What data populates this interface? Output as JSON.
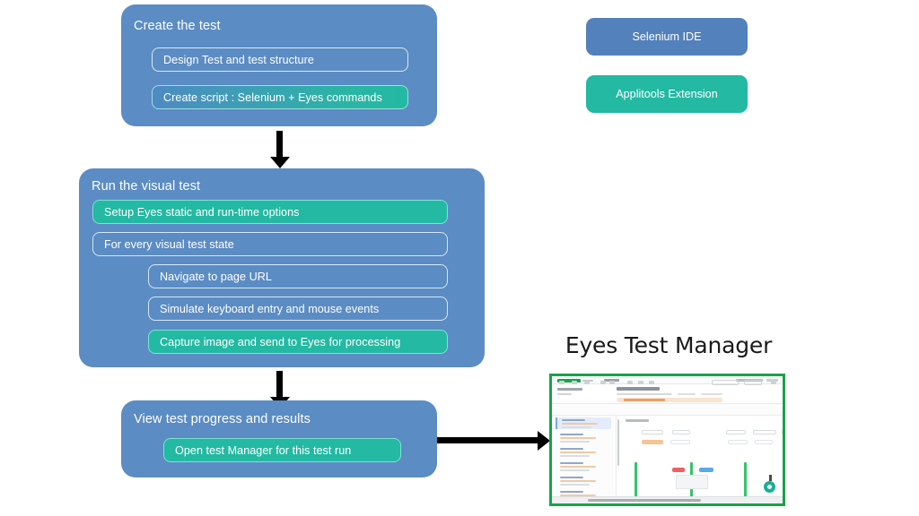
{
  "diagram": {
    "colors": {
      "blue": "#5b8cc4",
      "blue_button": "#5381bb",
      "teal": "#23b9a2",
      "frame_green": "#16a34a",
      "arrow": "#000000",
      "text_light": "#ffffff",
      "text_dark": "#1a1a1a"
    },
    "groups": [
      {
        "title": "Create the test",
        "rows": [
          {
            "label": "Design Test  and test structure",
            "style": "blue"
          },
          {
            "label": "Create script : Selenium + Eyes commands",
            "style": "grad"
          }
        ]
      },
      {
        "title": "Run the visual test",
        "rows": [
          {
            "label": "Setup Eyes static and run-time  options",
            "style": "teal"
          },
          {
            "label": "For every visual test state",
            "style": "blue"
          },
          {
            "label": "Navigate to page URL",
            "style": "blue"
          },
          {
            "label": "Simulate keyboard entry and mouse events",
            "style": "blue"
          },
          {
            "label": "Capture image and send to Eyes for processing",
            "style": "teal"
          }
        ]
      },
      {
        "title": "View test progress and results",
        "rows": [
          {
            "label": "Open  test Manager for this test run",
            "style": "teal"
          }
        ]
      }
    ],
    "tools": [
      {
        "label": "Selenium IDE",
        "style": "blue"
      },
      {
        "label": "Applitools Extension",
        "style": "teal"
      }
    ],
    "test_manager": {
      "title": "Eyes Test Manager"
    }
  }
}
